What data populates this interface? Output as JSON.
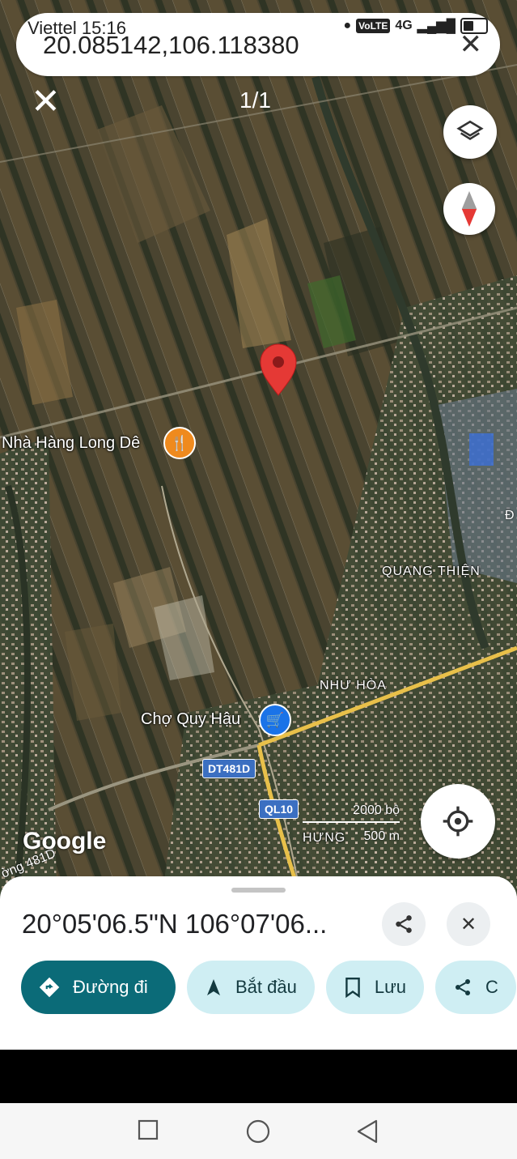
{
  "status_bar": {
    "carrier": "Viettel",
    "time": "15:16",
    "network": "4G",
    "volte": "VoLTE"
  },
  "search": {
    "query": "20.085142,106.118380",
    "clear_icon": "close-icon"
  },
  "map": {
    "result_counter": "1/1",
    "labels": {
      "restaurant": "Nhà Hàng Long Dê",
      "market": "Chợ Quy Hậu",
      "area_quang_thien": "QUANG THIỆN",
      "area_nhu_hoa": "NHƯ HÒA",
      "area_hung": "HƯNG",
      "road_481d_partial": "ờng 481D",
      "area_partial_d": "Đ"
    },
    "road_shields": {
      "dt481d": "DT481D",
      "ql10": "QL10"
    },
    "scale": {
      "imperial": "2000 bộ",
      "metric": "500 m"
    },
    "attribution": "Google",
    "colors": {
      "pin": "#e53935",
      "restaurant_poi": "#ef8a1e",
      "market_poi": "#1a73e8",
      "road_shield": "#3b6fc1"
    }
  },
  "sheet": {
    "title": "20°05'06.5\"N 106°07'06...",
    "actions": {
      "directions": "Đường đi",
      "start": "Bắt đầu",
      "save": "Lưu",
      "share_partial": "C"
    },
    "colors": {
      "primary_chip": "#0b6b78",
      "tonal_chip": "#cfeef3"
    }
  }
}
